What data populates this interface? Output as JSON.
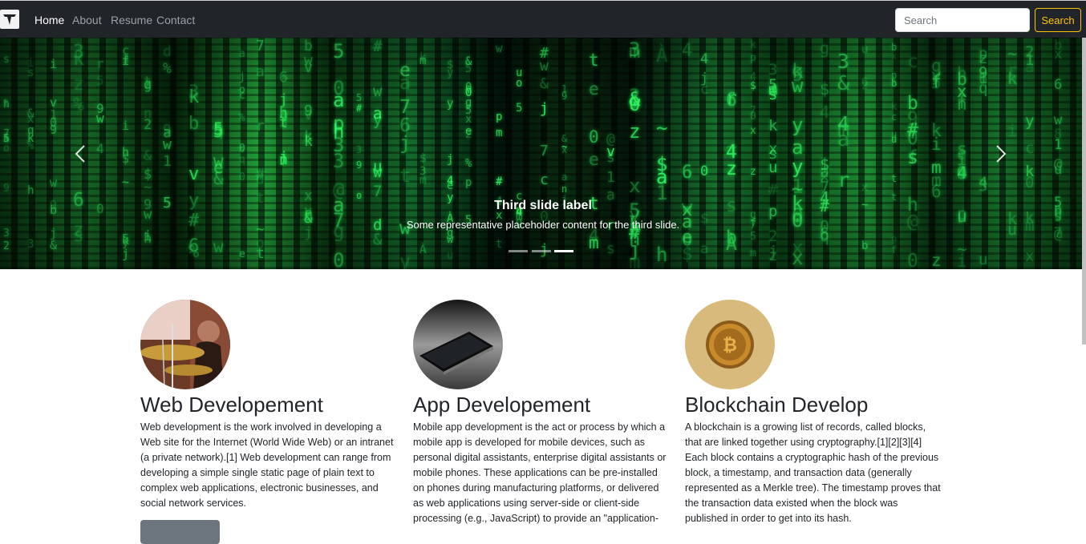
{
  "navbar": {
    "brand_icon": "tw-logo-icon",
    "links": [
      {
        "label": "Home",
        "active": true
      },
      {
        "label": "About",
        "active": false
      },
      {
        "label": "Resume",
        "active": false
      },
      {
        "label": "Contact",
        "active": false
      }
    ],
    "search": {
      "placeholder": "Search",
      "value": "",
      "button_label": "Search"
    },
    "colors": {
      "background": "#212529",
      "accent": "#ffc107"
    }
  },
  "carousel": {
    "caption_title": "Third slide label",
    "caption_text": "Some representative placeholder content for the third slide.",
    "prev_icon": "chevron-left-icon",
    "next_icon": "chevron-right-icon",
    "indicator_count": 3,
    "active_index": 2
  },
  "features": [
    {
      "title": "Web Developement",
      "image": "drummer-photo",
      "text": "Web development is the work involved in developing a Web site for the Internet (World Wide Web) or an intranet (a private network).[1] Web development can range from developing a simple single static page of plain text to complex web applications, electronic businesses, and social network services."
    },
    {
      "title": "App Developement",
      "image": "smartphone-photo",
      "text": "Mobile app development is the act or process by which a mobile app is developed for mobile devices, such as personal digital assistants, enterprise digital assistants or mobile phones. These applications can be pre-installed on phones during manufacturing platforms, or delivered as web applications using server-side or client-side processing (e.g., JavaScript) to provide an \"application-"
    },
    {
      "title": "Blockchain Develop",
      "image": "bitcoin-photo",
      "text": "A blockchain is a growing list of records, called blocks, that are linked together using cryptography.[1][2][3][4] Each block contains a cryptographic hash of the previous block, a timestamp, and transaction data (generally represented as a Merkle tree). The timestamp proves that the transaction data existed when the block was published in order to get into its hash."
    }
  ]
}
